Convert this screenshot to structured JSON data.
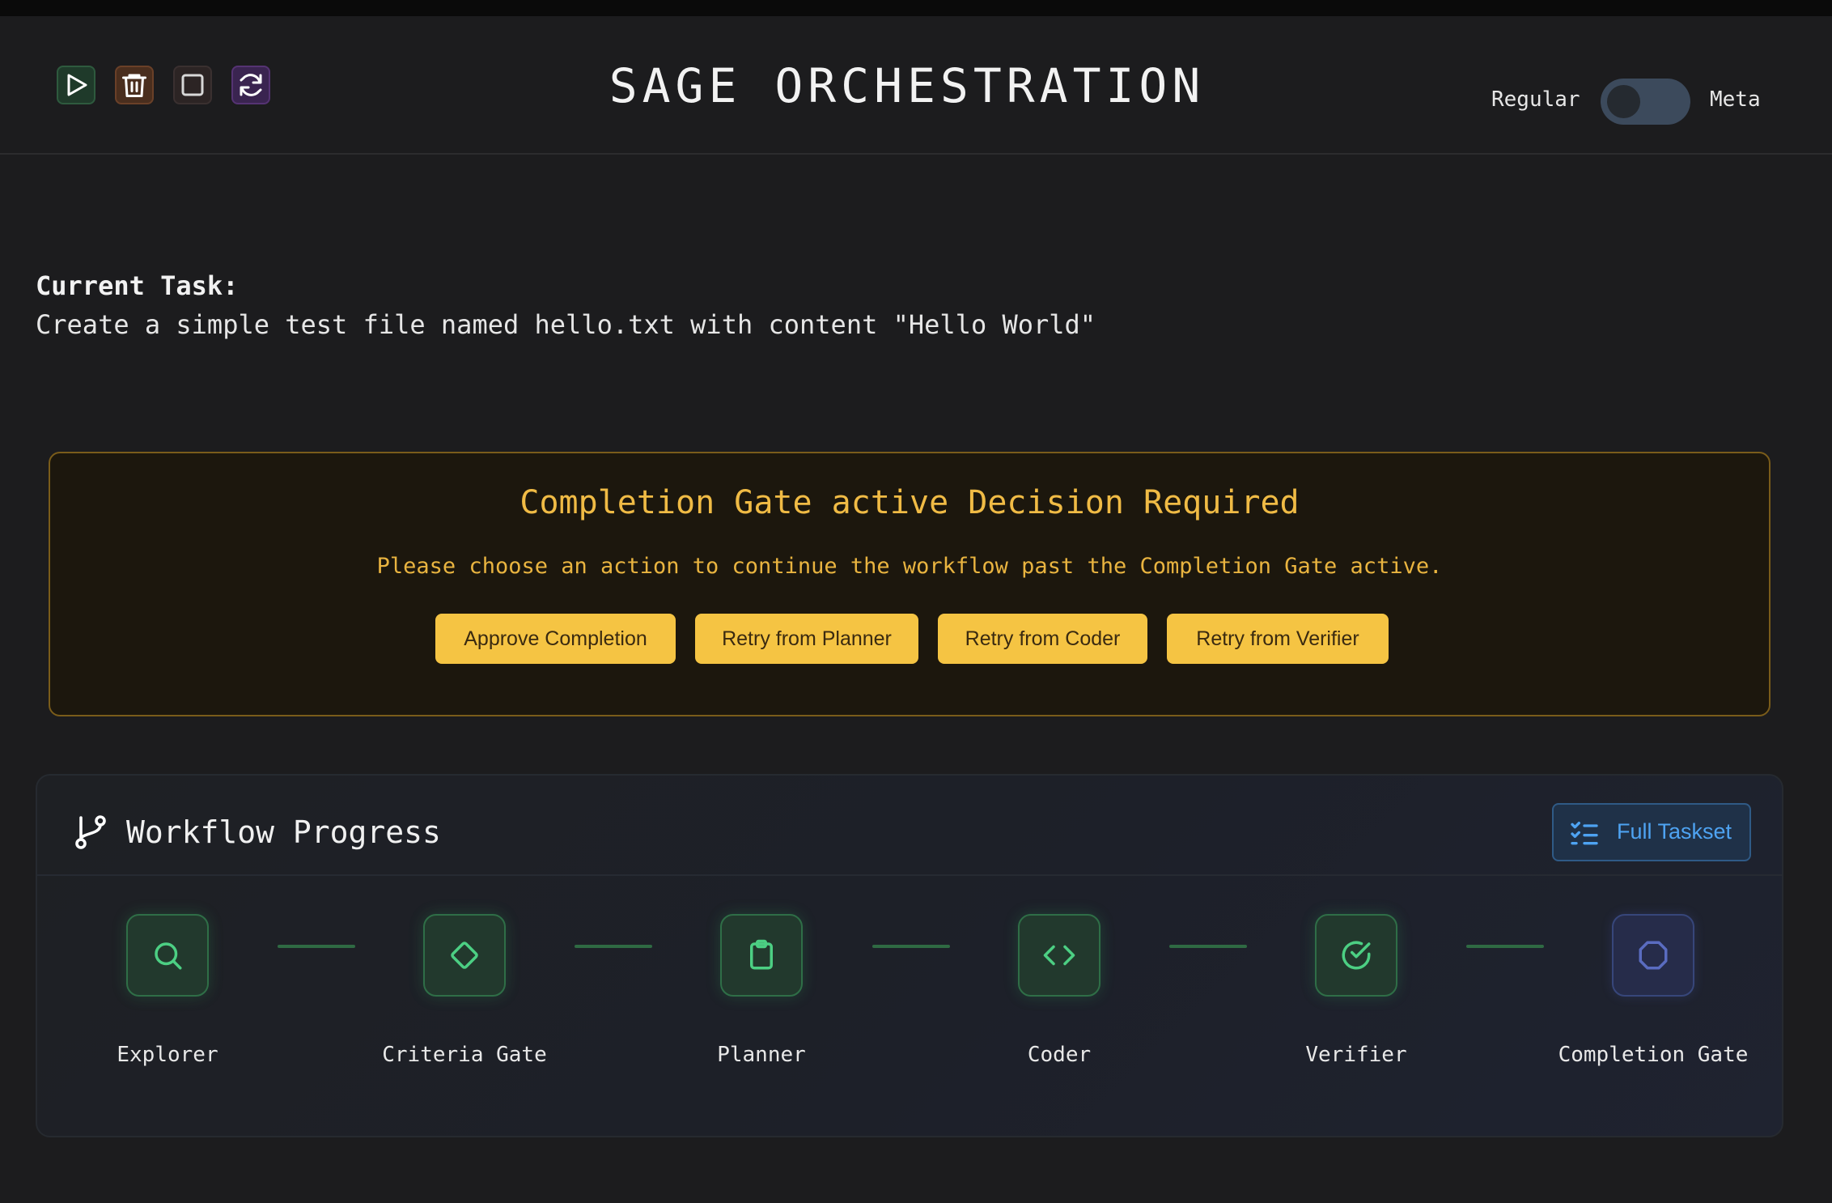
{
  "header": {
    "title": "SAGE ORCHESTRATION",
    "toolbar_icons": [
      "play-icon",
      "trash-icon",
      "stop-icon",
      "refresh-icon"
    ],
    "mode_toggle": {
      "left_label": "Regular",
      "right_label": "Meta",
      "state": "Regular"
    }
  },
  "task": {
    "label": "Current Task:",
    "text": "Create a simple test file named hello.txt with content \"Hello World\""
  },
  "gate": {
    "title": "Completion Gate active Decision Required",
    "description": "Please choose an action to continue the workflow past the Completion Gate active.",
    "buttons": [
      "Approve Completion",
      "Retry from Planner",
      "Retry from Coder",
      "Retry from Verifier"
    ]
  },
  "workflow": {
    "title": "Workflow Progress",
    "taskset_button": "Full Taskset",
    "steps": [
      {
        "label": "Explorer",
        "icon": "search-icon",
        "status": "completed"
      },
      {
        "label": "Criteria Gate",
        "icon": "diamond-icon",
        "status": "completed"
      },
      {
        "label": "Planner",
        "icon": "clipboard-icon",
        "status": "completed"
      },
      {
        "label": "Coder",
        "icon": "code-icon",
        "status": "completed"
      },
      {
        "label": "Verifier",
        "icon": "check-circle-icon",
        "status": "completed"
      },
      {
        "label": "Completion Gate",
        "icon": "octagon-icon",
        "status": "active"
      }
    ]
  },
  "colors": {
    "background": "#1c1c1e",
    "gate_accent": "#f5c443",
    "success": "#4ccf83",
    "pending": "#5a6cc0",
    "link": "#4ea3f2"
  }
}
